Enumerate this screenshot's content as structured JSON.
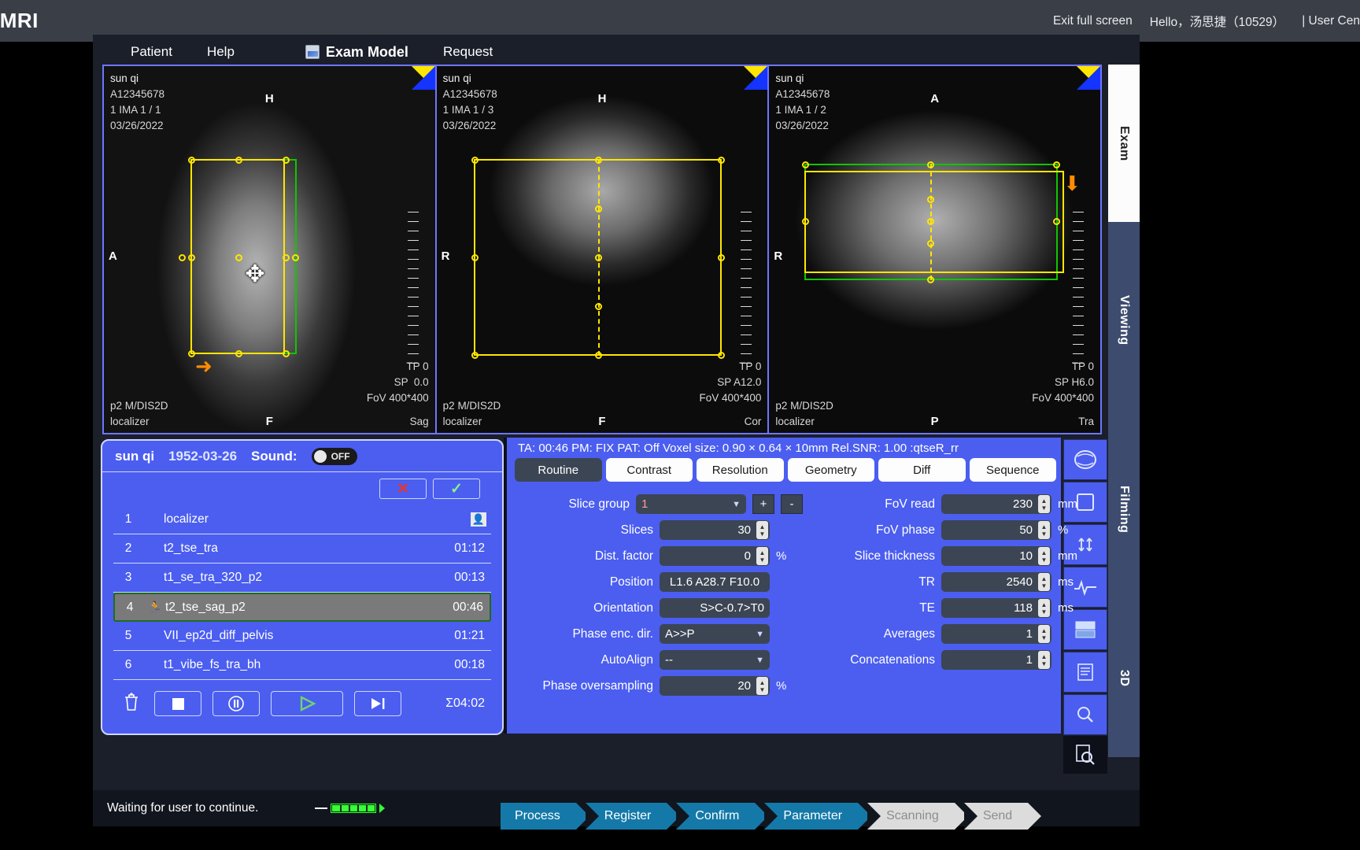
{
  "browser": {
    "brand": ".MRI",
    "exit_full_screen": "Exit full screen",
    "greeting": "Hello，汤思捷（10529）",
    "user_center": "| User Cen"
  },
  "menubar": {
    "items": [
      {
        "label": "Patient",
        "icon": ""
      },
      {
        "label": "Help",
        "icon": ""
      },
      {
        "label": "Exam Model",
        "icon": "exam-model-icon"
      },
      {
        "label": "Request",
        "icon": ""
      }
    ]
  },
  "viewports": [
    {
      "patient": "sun qi",
      "accession": "A12345678",
      "series": "1 IMA 1 / 1",
      "date": "03/26/2022",
      "orient_top": "H",
      "orient_left": "A",
      "orient_bottom": "F",
      "tp": "TP 0",
      "sp": "SP  0.0",
      "fov": "FoV 400*400",
      "protocol": "p2 M/DIS2D",
      "series_name": "localizer",
      "plane": "Sag"
    },
    {
      "patient": "sun qi",
      "accession": "A12345678",
      "series": "1 IMA 1 / 3",
      "date": "03/26/2022",
      "orient_top": "H",
      "orient_left": "R",
      "orient_bottom": "F",
      "tp": "TP 0",
      "sp": "SP A12.0",
      "fov": "FoV 400*400",
      "protocol": "p2 M/DIS2D",
      "series_name": "localizer",
      "plane": "Cor"
    },
    {
      "patient": "sun qi",
      "accession": "A12345678",
      "series": "1 IMA 1 / 2",
      "date": "03/26/2022",
      "orient_top": "A",
      "orient_left": "R",
      "orient_bottom": "P",
      "tp": "TP 0",
      "sp": "SP H6.0",
      "fov": "FoV 400*400",
      "protocol": "p2 M/DIS2D",
      "series_name": "localizer",
      "plane": "Tra"
    }
  ],
  "vtabs": [
    {
      "label": "Exam",
      "active": true
    },
    {
      "label": "Viewing",
      "active": false
    },
    {
      "label": "Filming",
      "active": false
    },
    {
      "label": "3D",
      "active": false
    }
  ],
  "tools": [
    {
      "name": "head-coil-icon",
      "glyph": "◓"
    },
    {
      "name": "square-roi-icon",
      "glyph": "▢"
    },
    {
      "name": "arrows-updown-icon",
      "glyph": "⇕"
    },
    {
      "name": "waveform-icon",
      "glyph": "∿"
    },
    {
      "name": "layout-icon",
      "glyph": "▤"
    },
    {
      "name": "document-icon",
      "glyph": "▤"
    },
    {
      "name": "search-icon",
      "glyph": "⚲"
    },
    {
      "name": "document-search-icon",
      "glyph": "⌕"
    }
  ],
  "queue": {
    "patient_name": "sun qi",
    "dob": "1952-03-26",
    "sound_label": "Sound:",
    "sound_state": "OFF",
    "cancel_label": "✕",
    "confirm_label": "✓",
    "rows": [
      {
        "num": "1",
        "name": "localizer",
        "time": "",
        "running": false,
        "has_person_icon": true
      },
      {
        "num": "2",
        "name": "t2_tse_tra",
        "time": "01:12",
        "running": false,
        "has_person_icon": false
      },
      {
        "num": "3",
        "name": "t1_se_tra_320_p2",
        "time": "00:13",
        "running": false,
        "has_person_icon": false
      },
      {
        "num": "4",
        "name": "t2_tse_sag_p2",
        "time": "00:46",
        "running": true,
        "has_person_icon": false
      },
      {
        "num": "5",
        "name": "VII_ep2d_diff_pelvis",
        "time": "01:21",
        "running": false,
        "has_person_icon": false
      },
      {
        "num": "6",
        "name": "t1_vibe_fs_tra_bh",
        "time": "00:18",
        "running": false,
        "has_person_icon": false
      }
    ],
    "controls": [
      {
        "name": "delete-button",
        "glyph": "🗑"
      },
      {
        "name": "stop-button",
        "glyph": "■"
      },
      {
        "name": "pause-button",
        "glyph": "⏸"
      },
      {
        "name": "play-button",
        "glyph": "▶"
      },
      {
        "name": "step-forward-button",
        "glyph": "▶|"
      }
    ],
    "total_time": "Σ04:02"
  },
  "params": {
    "summary": "TA: 00:46   PM: FIX   PAT: Off   Voxel size: 0.90 × 0.64 × 10mm   Rel.SNR: 1.00   :qtseR_rr",
    "tabs": [
      {
        "label": "Routine",
        "active": true
      },
      {
        "label": "Contrast",
        "active": false
      },
      {
        "label": "Resolution",
        "active": false
      },
      {
        "label": "Geometry",
        "active": false
      },
      {
        "label": "Diff",
        "active": false
      },
      {
        "label": "Sequence",
        "active": false
      }
    ],
    "left_fields": [
      {
        "label": "Slice group",
        "value": "1",
        "unit": "",
        "kind": "select"
      },
      {
        "label": "Slices",
        "value": "30",
        "unit": "",
        "kind": "spinner"
      },
      {
        "label": "Dist. factor",
        "value": "0",
        "unit": "%",
        "kind": "spinner"
      },
      {
        "label": "Position",
        "value": "L1.6 A28.7 F10.0",
        "unit": "",
        "kind": "text"
      },
      {
        "label": "Orientation",
        "value": "S>C-0.7>T0",
        "unit": "",
        "kind": "text"
      },
      {
        "label": "Phase enc. dir.",
        "value": "A>>P",
        "unit": "",
        "kind": "select"
      },
      {
        "label": "AutoAlign",
        "value": "--",
        "unit": "",
        "kind": "select"
      },
      {
        "label": "Phase oversampling",
        "value": "20",
        "unit": "%",
        "kind": "spinner"
      }
    ],
    "slice_group_plus": "+",
    "slice_group_minus": "-",
    "right_fields": [
      {
        "label": "FoV read",
        "value": "230",
        "unit": "mm",
        "kind": "spinner"
      },
      {
        "label": "FoV phase",
        "value": "50",
        "unit": "%",
        "kind": "spinner"
      },
      {
        "label": "Slice thickness",
        "value": "10",
        "unit": "mm",
        "kind": "spinner"
      },
      {
        "label": "TR",
        "value": "2540",
        "unit": "ms",
        "kind": "spinner"
      },
      {
        "label": "TE",
        "value": "118",
        "unit": "ms",
        "kind": "spinner"
      },
      {
        "label": "Averages",
        "value": "1",
        "unit": "",
        "kind": "spinner"
      },
      {
        "label": "Concatenations",
        "value": "1",
        "unit": "",
        "kind": "spinner"
      }
    ]
  },
  "status": {
    "message": "Waiting for user to continue.",
    "steps": [
      {
        "label": "Process",
        "done": true
      },
      {
        "label": "Register",
        "done": true
      },
      {
        "label": "Confirm",
        "done": true
      },
      {
        "label": "Parameter",
        "done": true
      },
      {
        "label": "Scanning",
        "done": false
      },
      {
        "label": "Send",
        "done": false
      }
    ]
  },
  "colors": {
    "panel_blue": "#4b5ef0",
    "slab_yellow": "#ffe600",
    "slab_green": "#12c400",
    "crumb_active": "#1479a8",
    "crumb_dim": "#dcdcdc"
  }
}
